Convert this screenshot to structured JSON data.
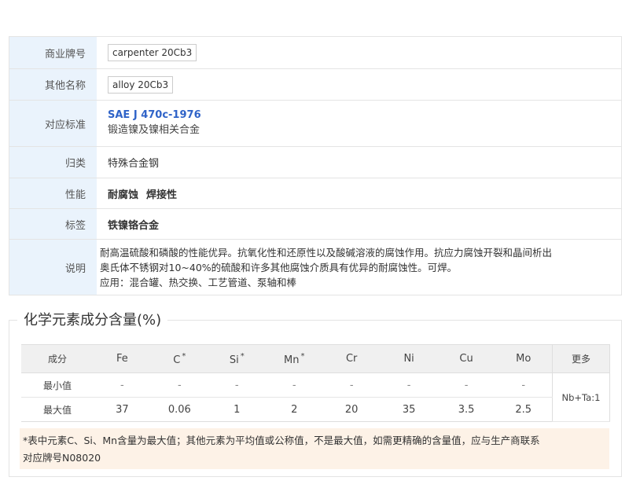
{
  "info": {
    "trade_label": "商业牌号",
    "trade_value": "carpenter 20Cb3",
    "other_label": "其他名称",
    "other_value": "alloy 20Cb3",
    "standard_label": "对应标准",
    "standard_code": "SAE J 470c-1976",
    "standard_desc": "锻造镍及镍相关合金",
    "category_label": "归类",
    "category_value": "特殊合金钢",
    "property_label": "性能",
    "properties": [
      "耐腐蚀",
      "焊接性"
    ],
    "tag_label": "标签",
    "tag_value": "铁镍铬合金",
    "desc_label": "说明",
    "desc_line1": "耐高温硫酸和磷酸的性能优异。抗氧化性和还原性以及酸碱溶液的腐蚀作用。抗应力腐蚀开裂和晶间析出",
    "desc_line2": "奥氏体不锈钢对10~40%的硫酸和许多其他腐蚀介质具有优异的耐腐蚀性。可焊。",
    "desc_line3": "应用：混合罐、热交换、工艺管道、泵轴和棒"
  },
  "composition": {
    "title": "化学元素成分含量(%)",
    "header_component": "成分",
    "elements": [
      "Fe",
      "C",
      "Si",
      "Mn",
      "Cr",
      "Ni",
      "Cu",
      "Mo"
    ],
    "star": "*",
    "more_label": "更多",
    "min_label": "最小值",
    "max_label": "最大值",
    "min_values": [
      "-",
      "-",
      "-",
      "-",
      "-",
      "-",
      "-",
      "-"
    ],
    "max_values": [
      "37",
      "0.06",
      "1",
      "2",
      "20",
      "35",
      "3.5",
      "2.5"
    ],
    "more_value": "Nb+Ta:1"
  },
  "note": {
    "line1": "*表中元素C、Si、Mn含量为最大值；其他元素为平均值或公称值，不是最大值，如需更精确的含量值，应与生产商联系",
    "line2": "对应牌号N08020"
  },
  "colors": {
    "label_bg": "#eaf3fc",
    "link": "#2f63c8",
    "note_bg": "#fdf2e7"
  }
}
